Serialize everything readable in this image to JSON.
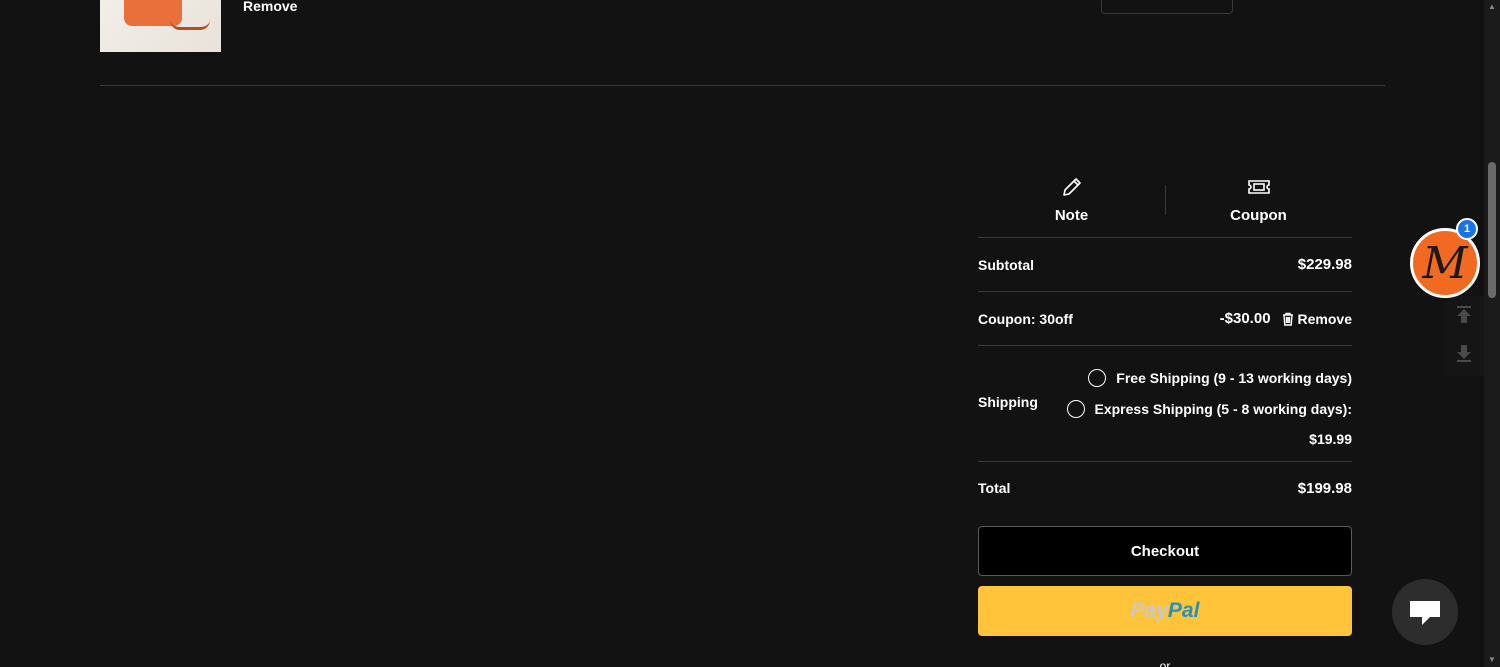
{
  "cart_item": {
    "remove_label": "Remove"
  },
  "actions": {
    "note_label": "Note",
    "coupon_label": "Coupon"
  },
  "summary": {
    "subtotal_label": "Subtotal",
    "subtotal_value": "$229.98",
    "coupon_label": "Coupon: 30off",
    "coupon_value": "-$30.00",
    "coupon_remove_label": "Remove",
    "shipping_label": "Shipping",
    "shipping_options": [
      {
        "label": "Free Shipping (9 - 13 working days)"
      },
      {
        "label": "Express Shipping (5 - 8 working days):"
      }
    ],
    "express_price": "$19.99",
    "total_label": "Total",
    "total_value": "$199.98"
  },
  "buttons": {
    "checkout_label": "Checkout",
    "paypal_part1": "Pay",
    "paypal_part2": "Pal"
  },
  "or_text": "or",
  "widgets": {
    "brand_letter": "M",
    "notification_count": "1"
  },
  "colors": {
    "background": "#121212",
    "paypal_yellow": "#ffc439",
    "brand_orange": "#f26a22",
    "badge_blue": "#1a73e8"
  },
  "icons": [
    "pencil-icon",
    "ticket-icon",
    "trash-icon",
    "arrow-up-icon",
    "arrow-down-icon",
    "chat-icon"
  ]
}
